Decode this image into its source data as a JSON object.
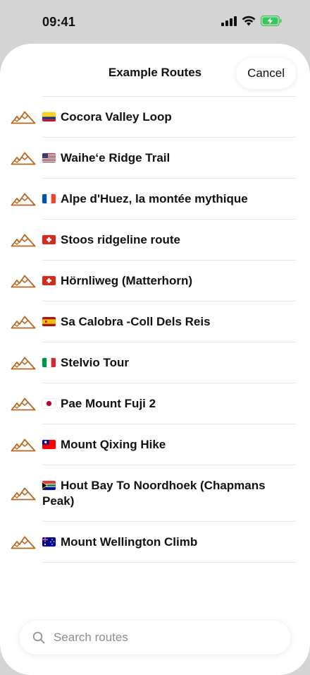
{
  "status": {
    "time": "09:41"
  },
  "sheet": {
    "title": "Example Routes",
    "cancel_label": "Cancel"
  },
  "routes": [
    {
      "flag": "CO",
      "name": "Cocora Valley Loop"
    },
    {
      "flag": "US",
      "name": "Waihe‘e Ridge Trail"
    },
    {
      "flag": "FR",
      "name": "Alpe d'Huez, la montée mythique"
    },
    {
      "flag": "CH",
      "name": "Stoos ridgeline route"
    },
    {
      "flag": "CH",
      "name": "Hörnliweg (Matterhorn)"
    },
    {
      "flag": "ES",
      "name": "Sa Calobra -Coll Dels Reis"
    },
    {
      "flag": "IT",
      "name": "Stelvio Tour"
    },
    {
      "flag": "JP",
      "name": "Pae Mount Fuji 2"
    },
    {
      "flag": "TW",
      "name": "Mount Qixing Hike"
    },
    {
      "flag": "ZA",
      "name": "Hout Bay To Noordhoek (Chapmans Peak)"
    },
    {
      "flag": "AU",
      "name": "Mount Wellington Climb"
    }
  ],
  "search": {
    "placeholder": "Search routes"
  },
  "colors": {
    "route_icon": "#b8651f",
    "battery": "#34c759"
  },
  "icons": {
    "route": "mountain-icon",
    "search": "magnifier-icon"
  }
}
